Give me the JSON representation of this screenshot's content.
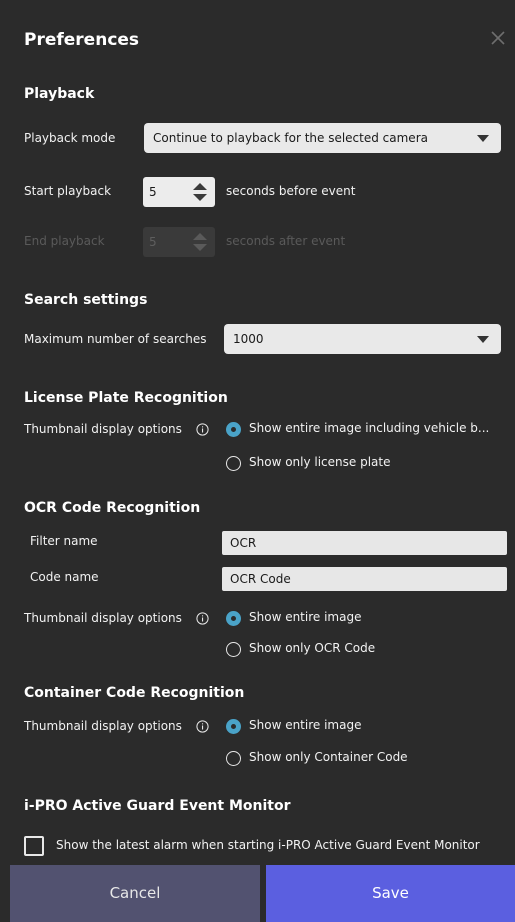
{
  "dialog": {
    "title": "Preferences",
    "close_icon": "close-icon"
  },
  "playback": {
    "heading": "Playback",
    "mode_label": "Playback mode",
    "mode_value": "Continue to playback for the selected camera",
    "start_label": "Start playback",
    "start_value": "5",
    "start_suffix": "seconds before event",
    "end_label": "End playback",
    "end_value": "5",
    "end_suffix": "seconds after event"
  },
  "search": {
    "heading": "Search settings",
    "max_label": "Maximum number of searches",
    "max_value": "1000"
  },
  "lpr": {
    "heading": "License Plate Recognition",
    "thumb_label": "Thumbnail display options",
    "option1": "Show entire image including vehicle b...",
    "option2": "Show only license plate",
    "selected": 1
  },
  "ocr": {
    "heading": "OCR Code Recognition",
    "filter_label": "Filter name",
    "filter_value": "OCR",
    "code_label": "Code name",
    "code_value": "OCR Code",
    "thumb_label": "Thumbnail display options",
    "option1": "Show entire image",
    "option2": "Show only OCR Code",
    "selected": 1
  },
  "container": {
    "heading": "Container Code Recognition",
    "thumb_label": "Thumbnail display options",
    "option1": "Show entire image",
    "option2": "Show only Container Code",
    "selected": 1
  },
  "guard": {
    "heading": "i-PRO Active Guard Event Monitor",
    "checkbox_label": "Show the latest alarm when starting i-PRO Active Guard Event Monitor",
    "checked": false
  },
  "footer": {
    "cancel": "Cancel",
    "save": "Save"
  },
  "colors": {
    "background": "#2b2b2b",
    "accent_radio": "#4aa3c8",
    "save": "#5b5fe0",
    "cancel": "#525270"
  }
}
